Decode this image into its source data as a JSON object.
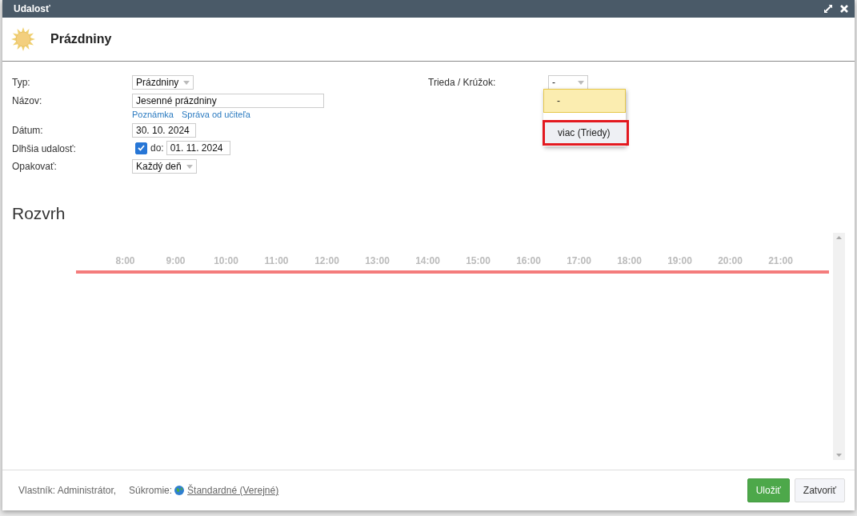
{
  "window": {
    "title": "Udalosť"
  },
  "header": {
    "title": "Prázdniny"
  },
  "form": {
    "fields": [
      {
        "kind": "select",
        "label": "Typ:",
        "value": "Prázdniny"
      },
      {
        "kind": "text",
        "label": "Názov:",
        "value": "Jesenné prázdniny",
        "links": [
          "Poznámka",
          "Správa od učiteľa"
        ]
      },
      {
        "kind": "date",
        "label": "Dátum:",
        "value": "30. 10. 2024"
      },
      {
        "kind": "range",
        "label": "Dlhšia udalosť:",
        "checked": true,
        "to_label": "do:",
        "value": "01. 11. 2024"
      },
      {
        "kind": "select",
        "label": "Opakovať:",
        "value": "Každý deň"
      }
    ],
    "class_field": {
      "label": "Trieda / Krúžok:",
      "value": "-",
      "expanded": true,
      "options": [
        {
          "label": "-",
          "selected": true,
          "highlighted": false
        },
        {
          "label": "viac (Triedy)",
          "selected": false,
          "highlighted": true
        }
      ]
    }
  },
  "schedule": {
    "title": "Rozvrh",
    "hours": [
      "8:00",
      "9:00",
      "10:00",
      "11:00",
      "12:00",
      "13:00",
      "14:00",
      "15:00",
      "16:00",
      "17:00",
      "18:00",
      "19:00",
      "20:00",
      "21:00"
    ]
  },
  "footer": {
    "owner": "Vlastník: Administrátor,",
    "privacy_label": "Súkromie:",
    "privacy_value": "Štandardné (Verejné)",
    "buttons": [
      {
        "label": "Uložiť",
        "kind": "primary"
      },
      {
        "label": "Zatvoriť",
        "kind": "default"
      }
    ]
  }
}
